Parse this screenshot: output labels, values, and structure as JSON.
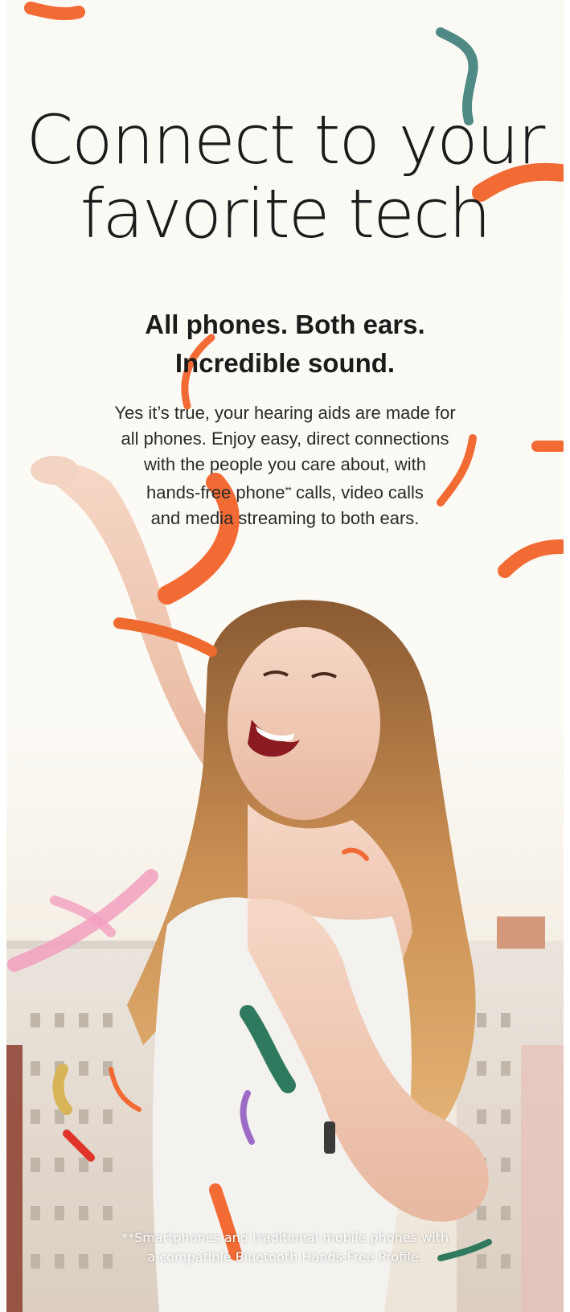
{
  "colors": {
    "background": "#fcfaf5",
    "text": "#1b1b1b",
    "confetti_orange": "#f26b35",
    "confetti_teal": "#4f8a84",
    "confetti_pink": "#f2a0c0"
  },
  "headline": {
    "line1": "Connect to your",
    "line2": "favorite tech"
  },
  "subhead": {
    "line1": "All phones. Both ears.",
    "line2": "Incredible sound."
  },
  "body": {
    "line1": "Yes it’s true, your hearing aids are made for",
    "line2": "all phones. Enjoy easy, direct connections",
    "line3": "with the people you care about, with",
    "line4_pre": "hands-free phone",
    "line4_mark": "**",
    "line4_post": " calls, video calls",
    "line5": "and media streaming to both ears."
  },
  "footnote": {
    "line1": "**Smartphones and traditional mobile phones with",
    "line2": "a compatible Bluetooth Hands-Free Profile."
  },
  "image": {
    "subject": "celebrating-woman-photo",
    "decoration": "confetti"
  }
}
